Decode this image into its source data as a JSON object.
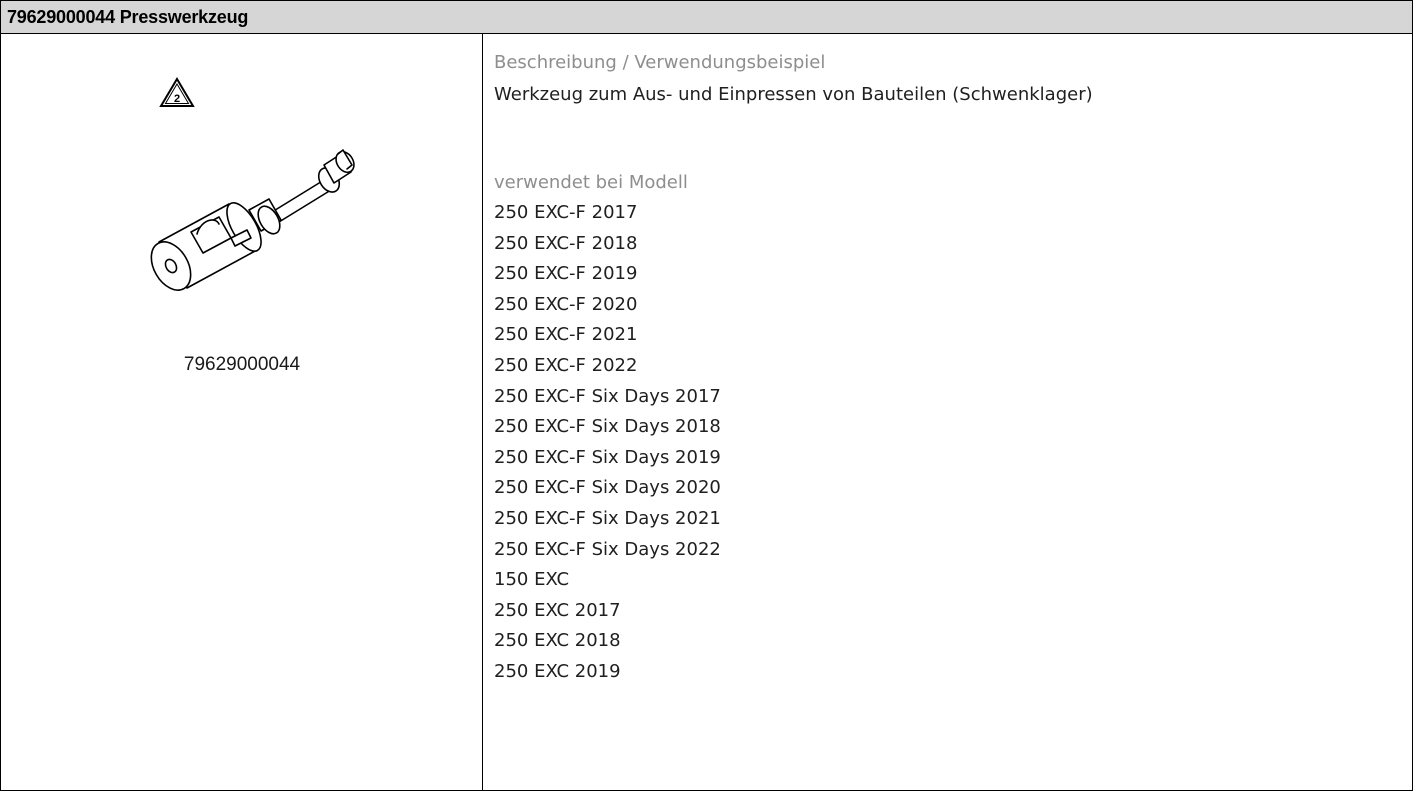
{
  "header": {
    "title": "79629000044 Presswerkzeug"
  },
  "left": {
    "warning_icon": "warning-triangle-2-icon",
    "warning_number": "2",
    "tool_image": "press-tool-drawing",
    "part_number": "79629000044"
  },
  "right": {
    "description_label": "Beschreibung / Verwendungsbeispiel",
    "description_text": "Werkzeug zum Aus- und Einpressen von Bauteilen (Schwenklager)",
    "models_label": "verwendet bei Modell",
    "models": [
      "250 EXC-F 2017",
      "250 EXC-F 2018",
      "250 EXC-F 2019",
      "250 EXC-F 2020",
      "250 EXC-F 2021",
      "250 EXC-F 2022",
      "250 EXC-F Six Days 2017",
      "250 EXC-F Six Days 2018",
      "250 EXC-F Six Days 2019",
      "250 EXC-F Six Days 2020",
      "250 EXC-F Six Days 2021",
      "250 EXC-F Six Days 2022",
      "150 EXC",
      "250 EXC 2017",
      "250 EXC 2018",
      "250 EXC 2019"
    ]
  },
  "colors": {
    "header_bg": "#d6d6d6",
    "label_grey": "#8e8e8e",
    "border": "#000000",
    "text": "#1f1f1f"
  }
}
